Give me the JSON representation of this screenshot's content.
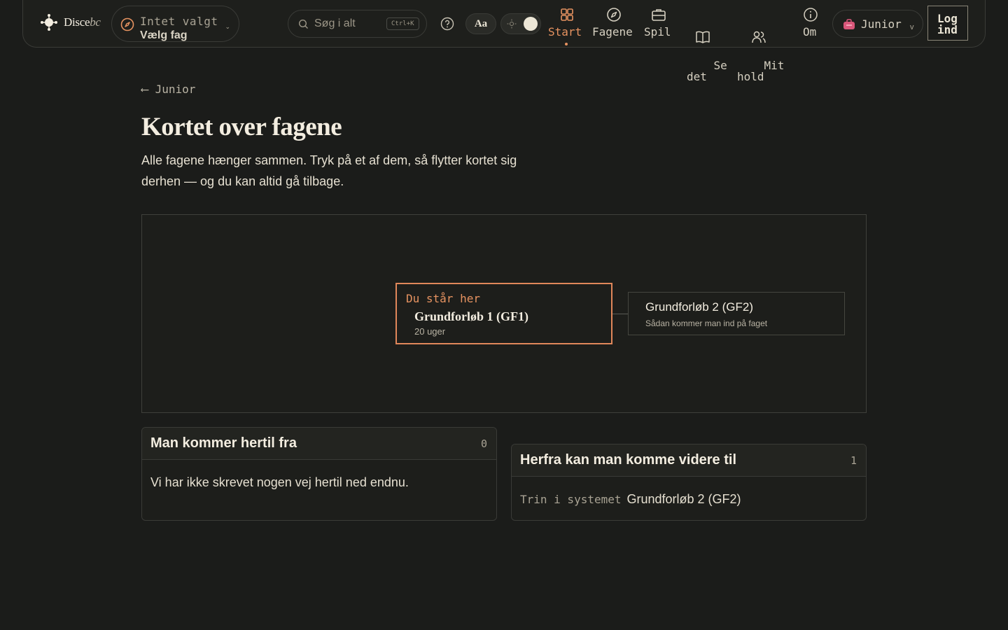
{
  "header": {
    "logo": {
      "main": "Disce",
      "accent": "bc"
    },
    "subject_picker": {
      "line1": "Intet valgt",
      "line2": "Vælg fag"
    },
    "search": {
      "placeholder": "Søg i alt",
      "shortcut": "Ctrl+K"
    },
    "font_button": "Aa",
    "nav": [
      {
        "label": "Start",
        "icon": "grid-icon",
        "active": true
      },
      {
        "label": "Fagene",
        "icon": "compass-icon"
      },
      {
        "label": "Spil",
        "icon": "briefcase-icon"
      },
      {
        "label": "Se\ndet",
        "icon": "book-icon"
      },
      {
        "label": "Mit\nhold",
        "icon": "users-icon"
      },
      {
        "label": "Om",
        "icon": "info-icon"
      }
    ],
    "level_selector": "Junior",
    "login": "Log\nind"
  },
  "page": {
    "back_label": "Junior",
    "title": "Kortet over fagene",
    "lead": "Alle fagene hænger sammen. Tryk på et af dem, så flytter kortet sig derhen — og du kan altid gå tilbage."
  },
  "map": {
    "current": {
      "here_label": "Du står her",
      "name": "Grundforløb 1 (GF1)",
      "sub": "20 uger"
    },
    "next": {
      "name": "Grundforløb 2 (GF2)",
      "sub": "Sådan kommer man ind på faget"
    }
  },
  "panels": {
    "from": {
      "title": "Man kommer hertil fra",
      "count": "0",
      "empty": "Vi har ikke skrevet nogen vej hertil ned endnu."
    },
    "to": {
      "title": "Herfra kan man komme videre til",
      "count": "1",
      "item_prefix": "Trin i systemet",
      "item_name": "Grundforløb 2 (GF2)"
    }
  },
  "colors": {
    "accent": "#e79361",
    "background": "#1b1c1a",
    "text": "#ece6d6"
  }
}
